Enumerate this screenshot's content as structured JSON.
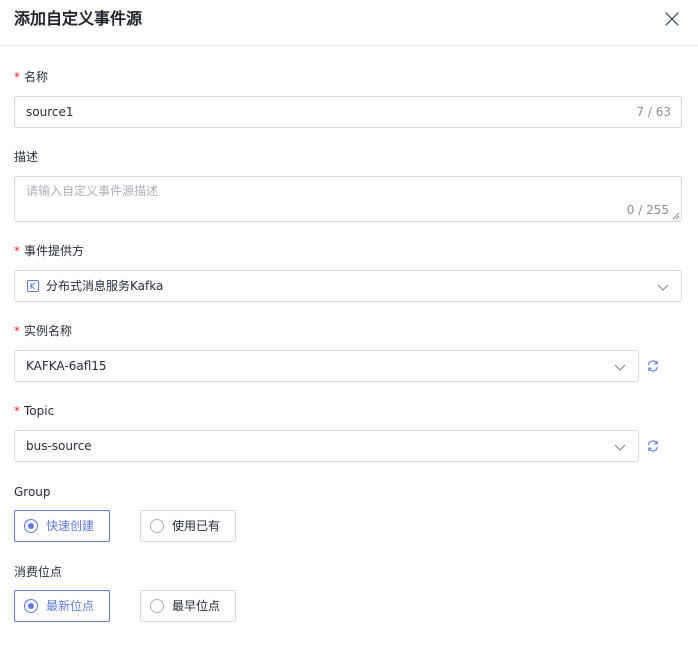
{
  "dialog": {
    "title": "添加自定义事件源"
  },
  "form": {
    "name": {
      "label": "名称",
      "value": "source1",
      "counter": "7 / 63"
    },
    "description": {
      "label": "描述",
      "placeholder": "请输入自定义事件源描述",
      "counter": "0 / 255"
    },
    "provider": {
      "label": "事件提供方",
      "value": "分布式消息服务Kafka"
    },
    "instance": {
      "label": "实例名称",
      "value": "KAFKA-6afl15"
    },
    "topic": {
      "label": "Topic",
      "value": "bus-source"
    },
    "group": {
      "label": "Group",
      "options": [
        "快速创建",
        "使用已有"
      ],
      "selected": "快速创建"
    },
    "offset": {
      "label": "消费位点",
      "options": [
        "最新位点",
        "最早位点"
      ],
      "selected": "最新位点"
    }
  },
  "colors": {
    "accent": "#5e7ce0",
    "required": "#f5222d",
    "border": "#d9d9d9"
  }
}
